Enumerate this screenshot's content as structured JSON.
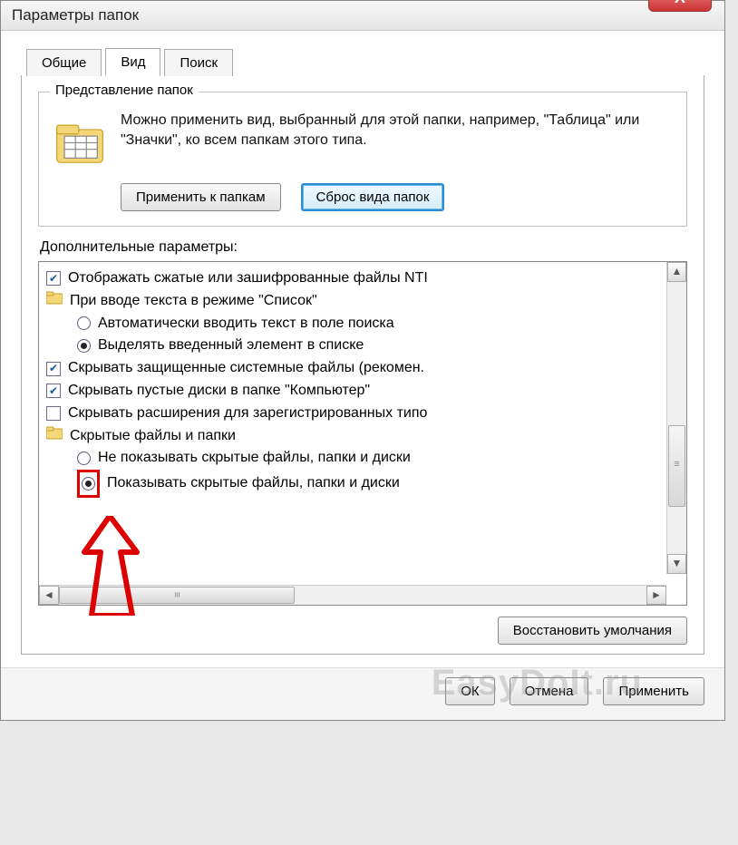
{
  "window": {
    "title": "Параметры папок",
    "close_label": "X"
  },
  "tabs": {
    "general": "Общие",
    "view": "Вид",
    "search": "Поиск"
  },
  "folder_views": {
    "group_label": "Представление папок",
    "description": "Можно применить вид, выбранный для этой папки, например, \"Таблица\" или \"Значки\", ко всем папкам этого типа.",
    "apply_btn": "Применить к папкам",
    "reset_btn": "Сброс вида папок"
  },
  "advanced": {
    "label": "Дополнительные параметры:",
    "items": [
      {
        "kind": "check",
        "checked": true,
        "text": "Отображать сжатые или зашифрованные файлы NTI"
      },
      {
        "kind": "folder",
        "text": "При вводе текста в режиме \"Список\""
      },
      {
        "kind": "radio",
        "checked": false,
        "indent": true,
        "text": "Автоматически вводить текст в поле поиска"
      },
      {
        "kind": "radio",
        "checked": true,
        "indent": true,
        "text": "Выделять введенный элемент в списке"
      },
      {
        "kind": "check",
        "checked": true,
        "text": "Скрывать защищенные системные файлы (рекомен."
      },
      {
        "kind": "check",
        "checked": true,
        "text": "Скрывать пустые диски в папке \"Компьютер\""
      },
      {
        "kind": "check",
        "checked": false,
        "text": "Скрывать расширения для зарегистрированных типо"
      },
      {
        "kind": "folder",
        "text": "Скрытые файлы и папки"
      },
      {
        "kind": "radio",
        "checked": false,
        "indent": true,
        "text": "Не показывать скрытые файлы, папки и диски"
      },
      {
        "kind": "radio",
        "checked": true,
        "indent": true,
        "highlight": true,
        "text": "Показывать скрытые файлы, папки и диски"
      }
    ],
    "restore_btn": "Восстановить умолчания"
  },
  "dialog_buttons": {
    "ok": "ОК",
    "cancel": "Отмена",
    "apply": "Применить"
  },
  "watermark": "EasyDoIt.ru"
}
